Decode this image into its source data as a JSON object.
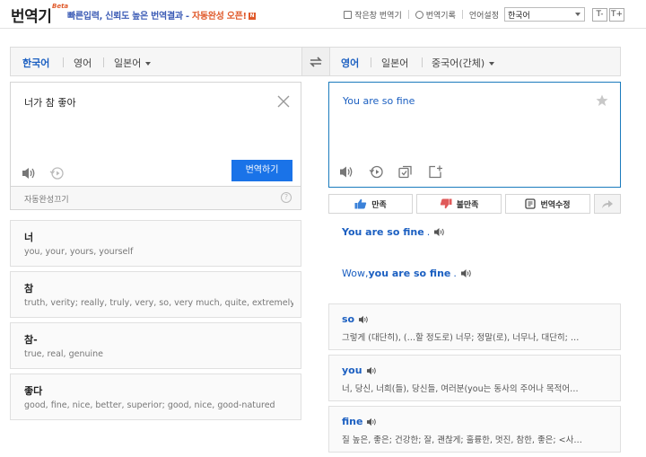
{
  "header": {
    "logo": "번역기",
    "beta": "Beta",
    "tagline_main": "빠른입력, 신뢰도 높은 번역결과 - ",
    "tagline_highlight": "자동완성 오픈!",
    "new_badge": "N",
    "small_window": "작은창 번역기",
    "history": "번역기록",
    "lang_setting": "언어설정",
    "lang_value": "한국어",
    "font_minus": "T-",
    "font_plus": "T+"
  },
  "source_langs": [
    {
      "label": "한국어",
      "active": true
    },
    {
      "label": "영어",
      "active": false
    },
    {
      "label": "일본어",
      "active": false
    }
  ],
  "target_langs": [
    {
      "label": "영어",
      "active": true
    },
    {
      "label": "일본어",
      "active": false
    },
    {
      "label": "중국어(간체)",
      "active": false
    }
  ],
  "source": {
    "text": "너가 참 좋아",
    "translate_button": "번역하기",
    "autocomplete_off": "자동완성끄기",
    "help": "?"
  },
  "target": {
    "text": "You are so fine"
  },
  "feedback": {
    "satisfied": "만족",
    "unsatisfied": "불만족",
    "edit": "번역수정"
  },
  "alternatives": [
    {
      "pre": "",
      "bold": "You are so fine",
      "post": "."
    },
    {
      "pre": "Wow, ",
      "bold": "you are so fine",
      "post": "."
    }
  ],
  "left_dict": [
    {
      "word": "너",
      "def": "you, your, yours, yourself"
    },
    {
      "word": "참",
      "def": "truth, verity; really, truly, very, so, very much, quite, extremely…"
    },
    {
      "word": "참-",
      "def": "true, real, genuine"
    },
    {
      "word": "좋다",
      "def": "good, fine, nice, better, superior; good, nice, good-natured"
    }
  ],
  "right_dict": [
    {
      "word": "so",
      "def": "그렇게 (대단히), (…할 정도로) 너무; 정말(로), 너무나, 대단히; …"
    },
    {
      "word": "you",
      "def": "너, 당신, 너희(들), 당신들, 여러분(you는 동사의 주어나 목적어…"
    },
    {
      "word": "fine",
      "def": "질 높은, 좋은; 건강한; 잘, 괜찮게; 훌륭한, 멋진, 참한, 좋은; <사…"
    }
  ],
  "colors": {
    "accent": "#1a73e8",
    "link": "#1b5fc1",
    "highlight": "#e05a2b"
  }
}
